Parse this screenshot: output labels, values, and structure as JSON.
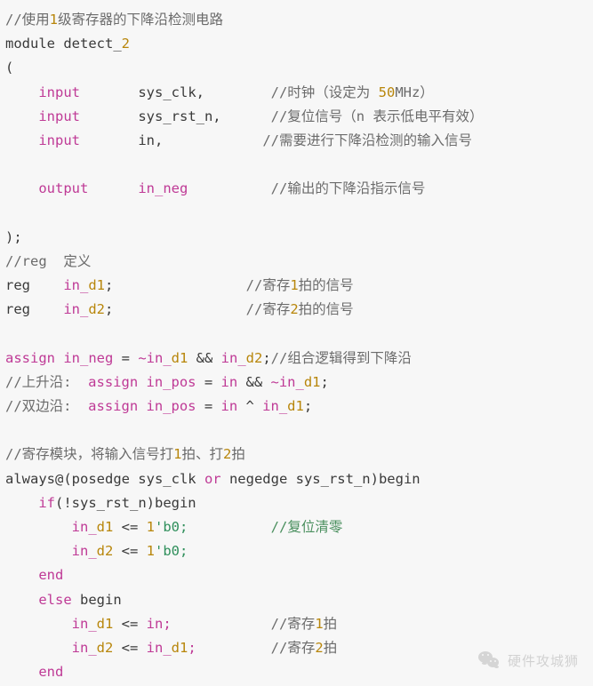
{
  "editor": {
    "language": "verilog",
    "background_color": "#f7f7f7",
    "colors": {
      "plain": "#3a3a3a",
      "keyword": "#bf3a96",
      "identifier": "#bf3a96",
      "number": "#b8860b",
      "comment": "#6b6b6b",
      "comment_green": "#4a8f5e",
      "string": "#2f8f5b"
    }
  },
  "code": {
    "lines": [
      {
        "tokens": [
          {
            "t": "//使用",
            "c": "comment"
          },
          {
            "t": "1",
            "c": "num"
          },
          {
            "t": "级寄存器的下降沿检测电路",
            "c": "comment"
          }
        ]
      },
      {
        "tokens": [
          {
            "t": "module detect_",
            "c": "plain"
          },
          {
            "t": "2",
            "c": "num"
          }
        ]
      },
      {
        "tokens": [
          {
            "t": "(",
            "c": "plain"
          }
        ]
      },
      {
        "tokens": [
          {
            "t": "    ",
            "c": "plain"
          },
          {
            "t": "input",
            "c": "key"
          },
          {
            "t": "       sys_clk,",
            "c": "plain"
          },
          {
            "t": "        ",
            "c": "plain"
          },
          {
            "t": "//时钟（设定为 ",
            "c": "comment"
          },
          {
            "t": "50",
            "c": "num"
          },
          {
            "t": "MHz）",
            "c": "comment"
          }
        ]
      },
      {
        "tokens": [
          {
            "t": "    ",
            "c": "plain"
          },
          {
            "t": "input",
            "c": "key"
          },
          {
            "t": "       sys_rst_n,",
            "c": "plain"
          },
          {
            "t": "      ",
            "c": "plain"
          },
          {
            "t": "//复位信号（n 表示低电平有效）",
            "c": "comment"
          }
        ]
      },
      {
        "tokens": [
          {
            "t": "    ",
            "c": "plain"
          },
          {
            "t": "input",
            "c": "key"
          },
          {
            "t": "       in,",
            "c": "plain"
          },
          {
            "t": "            ",
            "c": "plain"
          },
          {
            "t": "//需要进行下降沿检测的输入信号",
            "c": "comment"
          }
        ]
      },
      {
        "tokens": [
          {
            "t": "",
            "c": "plain"
          }
        ]
      },
      {
        "tokens": [
          {
            "t": "    ",
            "c": "plain"
          },
          {
            "t": "output",
            "c": "key"
          },
          {
            "t": "      ",
            "c": "plain"
          },
          {
            "t": "in_neg",
            "c": "ident"
          },
          {
            "t": "          ",
            "c": "plain"
          },
          {
            "t": "//输出的下降沿指示信号",
            "c": "comment"
          }
        ]
      },
      {
        "tokens": [
          {
            "t": "",
            "c": "plain"
          }
        ]
      },
      {
        "tokens": [
          {
            "t": ");",
            "c": "plain"
          }
        ]
      },
      {
        "tokens": [
          {
            "t": "//reg  定义",
            "c": "comment"
          }
        ]
      },
      {
        "tokens": [
          {
            "t": "reg",
            "c": "plain"
          },
          {
            "t": "    ",
            "c": "plain"
          },
          {
            "t": "in_",
            "c": "ident"
          },
          {
            "t": "d1",
            "c": "num"
          },
          {
            "t": ";",
            "c": "plain"
          },
          {
            "t": "                ",
            "c": "plain"
          },
          {
            "t": "//寄存",
            "c": "comment"
          },
          {
            "t": "1",
            "c": "num"
          },
          {
            "t": "拍的信号",
            "c": "comment"
          }
        ]
      },
      {
        "tokens": [
          {
            "t": "reg",
            "c": "plain"
          },
          {
            "t": "    ",
            "c": "plain"
          },
          {
            "t": "in_",
            "c": "ident"
          },
          {
            "t": "d2",
            "c": "num"
          },
          {
            "t": ";",
            "c": "plain"
          },
          {
            "t": "                ",
            "c": "plain"
          },
          {
            "t": "//寄存",
            "c": "comment"
          },
          {
            "t": "2",
            "c": "num"
          },
          {
            "t": "拍的信号",
            "c": "comment"
          }
        ]
      },
      {
        "tokens": [
          {
            "t": "",
            "c": "plain"
          }
        ]
      },
      {
        "tokens": [
          {
            "t": "assign in_neg",
            "c": "key"
          },
          {
            "t": " = ",
            "c": "plain"
          },
          {
            "t": "~in_",
            "c": "ident"
          },
          {
            "t": "d1",
            "c": "num"
          },
          {
            "t": " && ",
            "c": "plain"
          },
          {
            "t": "in_",
            "c": "ident"
          },
          {
            "t": "d2",
            "c": "num"
          },
          {
            "t": ";",
            "c": "plain"
          },
          {
            "t": "//组合逻辑得到下降沿",
            "c": "comment"
          }
        ]
      },
      {
        "tokens": [
          {
            "t": "//上升沿:",
            "c": "comment"
          },
          {
            "t": "  ",
            "c": "plain"
          },
          {
            "t": "assign in_pos",
            "c": "key"
          },
          {
            "t": " = ",
            "c": "plain"
          },
          {
            "t": "in",
            "c": "ident"
          },
          {
            "t": " && ",
            "c": "plain"
          },
          {
            "t": "~in_",
            "c": "ident"
          },
          {
            "t": "d1",
            "c": "num"
          },
          {
            "t": ";",
            "c": "plain"
          }
        ]
      },
      {
        "tokens": [
          {
            "t": "//双边沿:",
            "c": "comment"
          },
          {
            "t": "  ",
            "c": "plain"
          },
          {
            "t": "assign in_pos",
            "c": "key"
          },
          {
            "t": " = ",
            "c": "plain"
          },
          {
            "t": "in",
            "c": "ident"
          },
          {
            "t": " ^ ",
            "c": "plain"
          },
          {
            "t": "in_",
            "c": "ident"
          },
          {
            "t": "d1",
            "c": "num"
          },
          {
            "t": ";",
            "c": "plain"
          }
        ]
      },
      {
        "tokens": [
          {
            "t": "",
            "c": "plain"
          }
        ]
      },
      {
        "tokens": [
          {
            "t": "//寄存模块，将输入信号打",
            "c": "comment"
          },
          {
            "t": "1",
            "c": "num"
          },
          {
            "t": "拍、打",
            "c": "comment"
          },
          {
            "t": "2",
            "c": "num"
          },
          {
            "t": "拍",
            "c": "comment"
          }
        ]
      },
      {
        "tokens": [
          {
            "t": "always@(posedge sys_clk ",
            "c": "plain"
          },
          {
            "t": "or",
            "c": "key"
          },
          {
            "t": " negedge sys_rst_n)begin",
            "c": "plain"
          }
        ]
      },
      {
        "tokens": [
          {
            "t": "    ",
            "c": "plain"
          },
          {
            "t": "if",
            "c": "key"
          },
          {
            "t": "(!sys_rst_n)begin",
            "c": "plain"
          }
        ]
      },
      {
        "tokens": [
          {
            "t": "        ",
            "c": "plain"
          },
          {
            "t": "in_",
            "c": "ident"
          },
          {
            "t": "d1",
            "c": "num"
          },
          {
            "t": " <= ",
            "c": "plain"
          },
          {
            "t": "1",
            "c": "num"
          },
          {
            "t": "'b0;",
            "c": "string"
          },
          {
            "t": "          ",
            "c": "plain"
          },
          {
            "t": "//复位清零",
            "c": "comment-green"
          }
        ]
      },
      {
        "tokens": [
          {
            "t": "        ",
            "c": "plain"
          },
          {
            "t": "in_",
            "c": "ident"
          },
          {
            "t": "d2",
            "c": "num"
          },
          {
            "t": " <= ",
            "c": "plain"
          },
          {
            "t": "1",
            "c": "num"
          },
          {
            "t": "'b0;",
            "c": "string"
          }
        ]
      },
      {
        "tokens": [
          {
            "t": "    ",
            "c": "plain"
          },
          {
            "t": "end",
            "c": "key"
          }
        ]
      },
      {
        "tokens": [
          {
            "t": "    ",
            "c": "plain"
          },
          {
            "t": "else",
            "c": "key"
          },
          {
            "t": " begin",
            "c": "plain"
          }
        ]
      },
      {
        "tokens": [
          {
            "t": "        ",
            "c": "plain"
          },
          {
            "t": "in_",
            "c": "ident"
          },
          {
            "t": "d1",
            "c": "num"
          },
          {
            "t": " <= ",
            "c": "plain"
          },
          {
            "t": "in;",
            "c": "ident"
          },
          {
            "t": "            ",
            "c": "plain"
          },
          {
            "t": "//寄存",
            "c": "comment"
          },
          {
            "t": "1",
            "c": "num"
          },
          {
            "t": "拍",
            "c": "comment"
          }
        ]
      },
      {
        "tokens": [
          {
            "t": "        ",
            "c": "plain"
          },
          {
            "t": "in_",
            "c": "ident"
          },
          {
            "t": "d2",
            "c": "num"
          },
          {
            "t": " <= ",
            "c": "plain"
          },
          {
            "t": "in_",
            "c": "ident"
          },
          {
            "t": "d1",
            "c": "num"
          },
          {
            "t": ";",
            "c": "ident"
          },
          {
            "t": "         ",
            "c": "plain"
          },
          {
            "t": "//寄存",
            "c": "comment"
          },
          {
            "t": "2",
            "c": "num"
          },
          {
            "t": "拍",
            "c": "comment"
          }
        ]
      },
      {
        "tokens": [
          {
            "t": "    ",
            "c": "plain"
          },
          {
            "t": "end",
            "c": "key"
          }
        ]
      }
    ]
  },
  "watermark": {
    "text": "硬件攻城狮",
    "logo": "wechat-icon"
  }
}
